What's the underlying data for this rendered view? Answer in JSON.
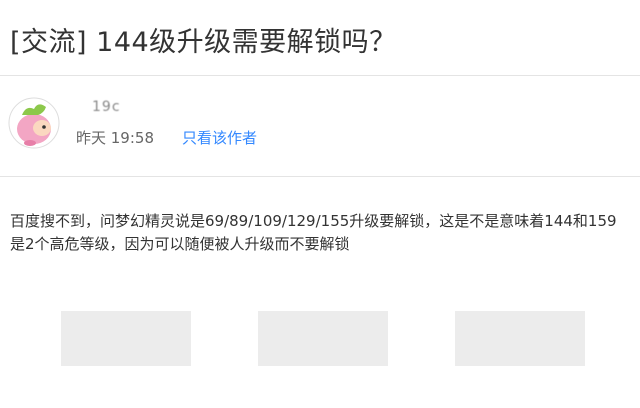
{
  "post": {
    "title": "[交流] 144级升级需要解锁吗？",
    "author_name": "19c",
    "time": "昨天 19:58",
    "only_author_link": "只看该作者",
    "body": "百度搜不到，问梦幻精灵说是69/89/109/129/155升级要解锁，这是不是意味着144和159是2个高危等级，因为可以随便被人升级而不要解锁"
  },
  "colors": {
    "link": "#3388ff",
    "divider": "#e4e4e4",
    "placeholder": "#ececec"
  }
}
